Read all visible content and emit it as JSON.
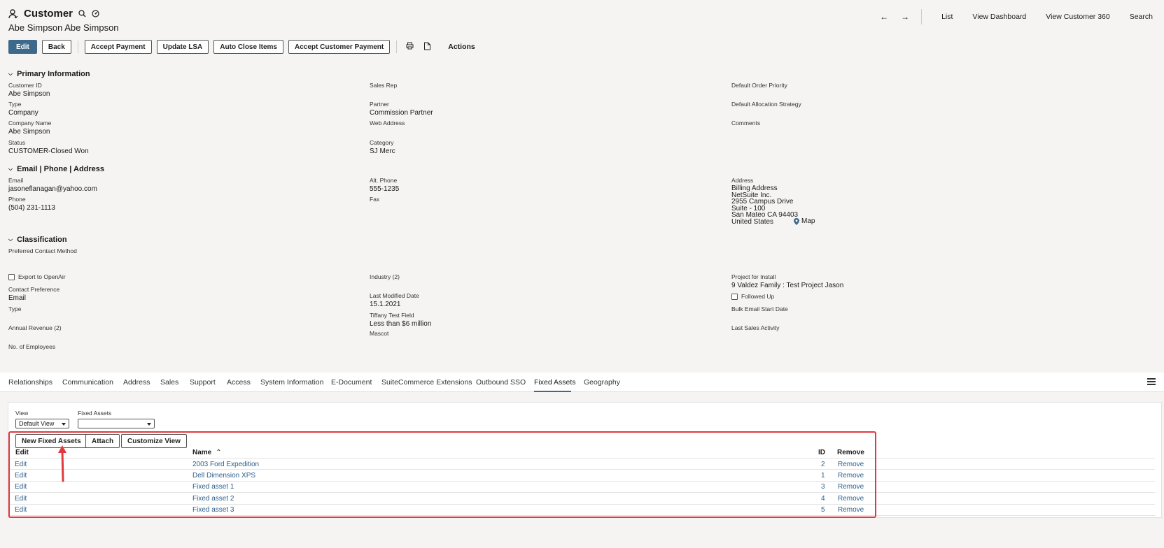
{
  "header": {
    "record_type": "Customer",
    "record_name": "Abe Simpson Abe Simpson",
    "nav": {
      "back_arrow": "←",
      "forward_arrow": "→",
      "links": [
        "List",
        "View Dashboard",
        "View Customer 360",
        "Search"
      ]
    }
  },
  "toolbar": {
    "edit": "Edit",
    "back": "Back",
    "accept_payment": "Accept Payment",
    "update_lsa": "Update LSA",
    "auto_close_items": "Auto Close Items",
    "accept_customer_payment": "Accept Customer Payment",
    "actions": "Actions"
  },
  "primary": {
    "title": "Primary Information",
    "customer_id_label": "Customer ID",
    "customer_id": "Abe Simpson",
    "type_label": "Type",
    "type": "Company",
    "company_name_label": "Company Name",
    "company_name": "Abe Simpson",
    "status_label": "Status",
    "status": "CUSTOMER-Closed Won",
    "sales_rep_label": "Sales Rep",
    "partner_label": "Partner",
    "partner": "Commission Partner",
    "web_address_label": "Web Address",
    "category_label": "Category",
    "category": "SJ Merc",
    "default_order_priority_label": "Default Order Priority",
    "default_allocation_strategy_label": "Default Allocation Strategy",
    "comments_label": "Comments"
  },
  "contact": {
    "title": "Email | Phone | Address",
    "email_label": "Email",
    "email": "jasoneflanagan@yahoo.com",
    "phone_label": "Phone",
    "phone": "(504) 231-1113",
    "alt_phone_label": "Alt. Phone",
    "alt_phone": "555-1235",
    "fax_label": "Fax",
    "address_label": "Address",
    "address_lines": [
      "Billing Address",
      "NetSuite Inc.",
      "2955 Campus Drive",
      "Suite - 100",
      "San Mateo CA 94403",
      "United States"
    ],
    "map_label": "Map"
  },
  "classification": {
    "title": "Classification",
    "preferred_contact_method_label": "Preferred Contact Method",
    "export_openair_label": "Export to OpenAir",
    "contact_preference_label": "Contact Preference",
    "contact_preference": "Email",
    "type_label": "Type",
    "annual_revenue_label": "Annual Revenue (2)",
    "no_employees_label": "No. of Employees",
    "industry_label": "Industry (2)",
    "last_modified_label": "Last Modified Date",
    "last_modified": "15.1.2021",
    "tiffany_label": "Tiffany Test Field",
    "tiffany": "Less than $6 million",
    "mascot_label": "Mascot",
    "project_install_label": "Project for Install",
    "project_install": "9 Valdez Family : Test Project Jason",
    "followed_up_label": "Followed Up",
    "bulk_email_label": "Bulk Email Start Date",
    "last_sales_activity_label": "Last Sales Activity"
  },
  "tabs": [
    "Relationships",
    "Communication",
    "Address",
    "Sales",
    "Support",
    "Access",
    "System Information",
    "E-Document",
    "SuiteCommerce Extensions",
    "Outbound SSO",
    "Fixed Assets",
    "Geography"
  ],
  "active_tab": "Fixed Assets",
  "fixed_assets": {
    "view_label": "View",
    "view_value": "Default View",
    "filter_label": "Fixed Assets",
    "filter_value": "",
    "new_button": "New Fixed Assets",
    "attach_button": "Attach",
    "customize_button": "Customize View",
    "columns": {
      "edit": "Edit",
      "name": "Name",
      "sort_indicator": "⌃",
      "id": "ID",
      "remove": "Remove"
    },
    "rows": [
      {
        "edit": "Edit",
        "name": "2003 Ford Expedition",
        "id": "2",
        "remove": "Remove"
      },
      {
        "edit": "Edit",
        "name": "Dell Dimension XPS",
        "id": "1",
        "remove": "Remove"
      },
      {
        "edit": "Edit",
        "name": "Fixed asset 1",
        "id": "3",
        "remove": "Remove"
      },
      {
        "edit": "Edit",
        "name": "Fixed asset 2",
        "id": "4",
        "remove": "Remove"
      },
      {
        "edit": "Edit",
        "name": "Fixed asset 3",
        "id": "5",
        "remove": "Remove"
      }
    ]
  },
  "colors": {
    "accent": "#3d6a8a",
    "link": "#2c5e8c",
    "annotation": "#e0393e"
  }
}
